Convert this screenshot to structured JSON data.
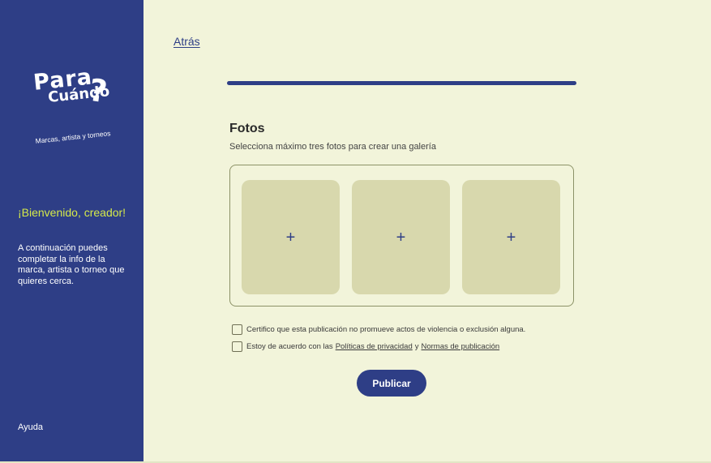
{
  "sidebar": {
    "logo": {
      "line1": "Para",
      "line2": "Cuándo",
      "question": "?",
      "tagline": "Marcas, artista y torneos"
    },
    "welcome": "¡Bienvenido, creador!",
    "intro": "A continuación puedes completar la info de la marca, artista o torneo que quieres cerca.",
    "help": "Ayuda"
  },
  "header": {
    "back_label": "Atrás"
  },
  "progress": {
    "value": 1.0
  },
  "photos": {
    "title": "Fotos",
    "subtitle": "Selecciona  máximo tres fotos para crear una galería",
    "slots": [
      {
        "label": "+"
      },
      {
        "label": "+"
      },
      {
        "label": "+"
      }
    ]
  },
  "agreements": {
    "certify": "Certifico que esta publicación no promueve actos de violencia o exclusión alguna.",
    "terms_prefix": "Estoy de acuerdo con las",
    "privacy_link": "Políticas de privacidad",
    "and": "y",
    "rules_link": "Normas de publicación"
  },
  "actions": {
    "publish_label": "Publicar"
  },
  "colors": {
    "sidebar": "#2E3E86",
    "background": "#F2F4DA",
    "accent": "#D5E94A",
    "slot": "#D8D8AD"
  },
  "icons": {
    "add": "plus-icon"
  }
}
